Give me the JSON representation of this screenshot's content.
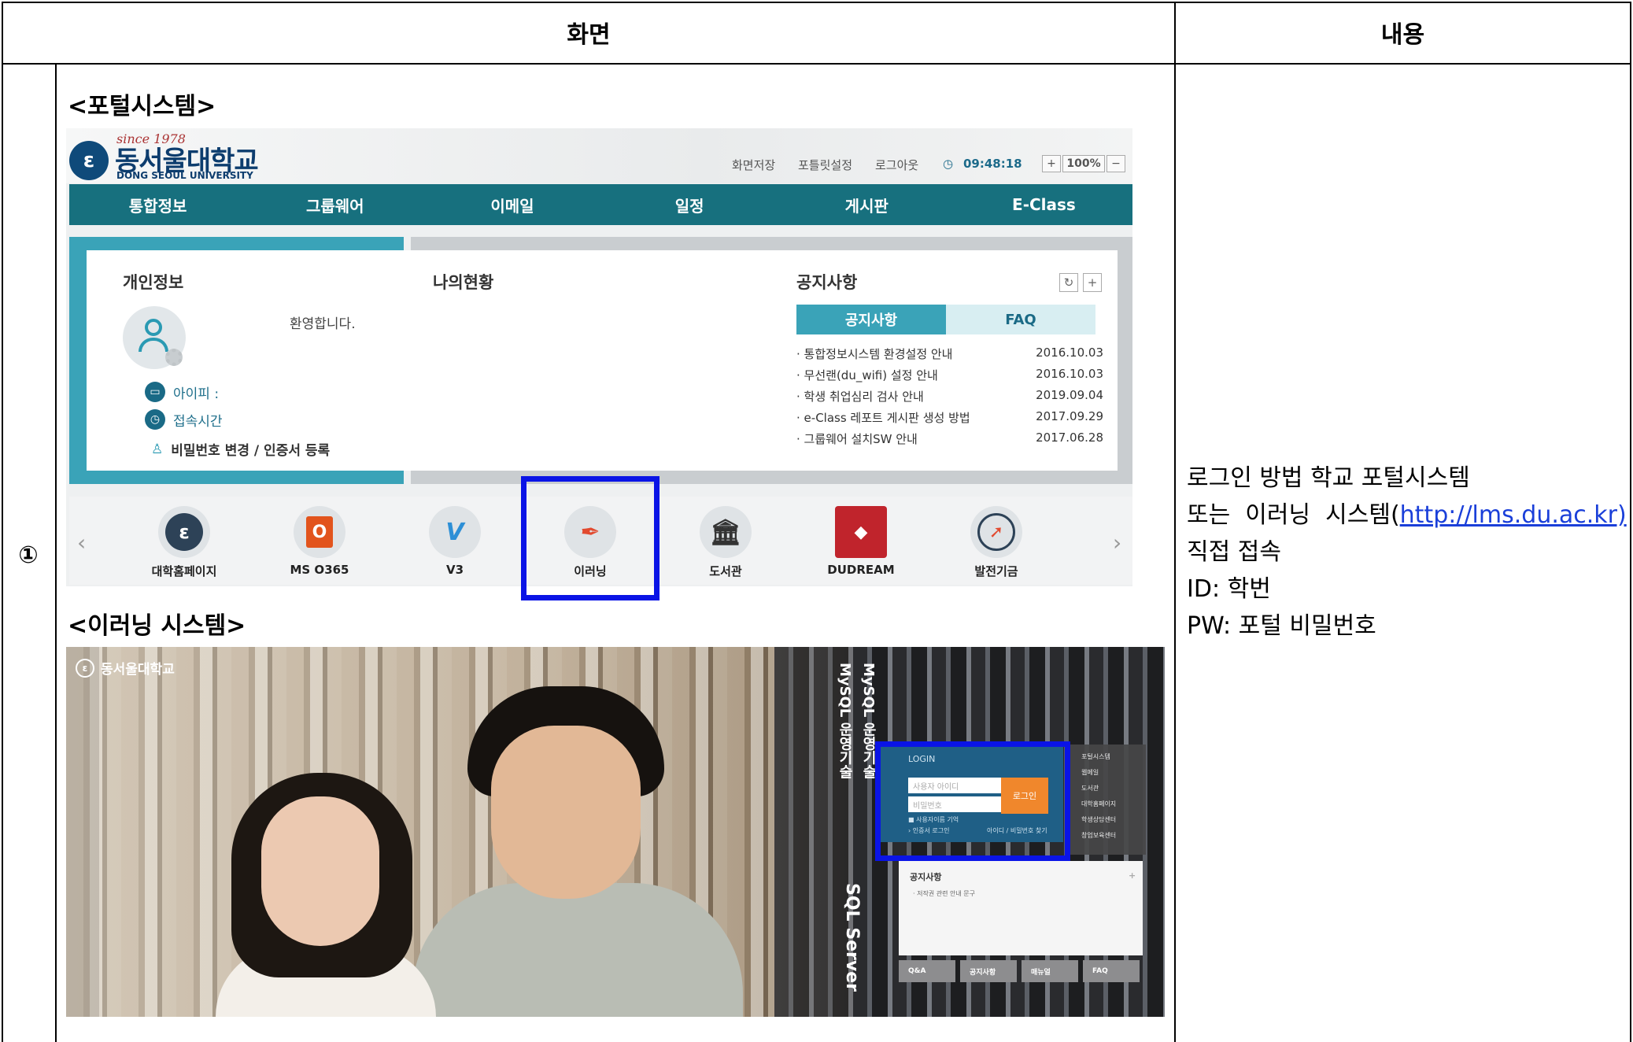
{
  "table": {
    "header_screen": "화면",
    "header_content": "내용",
    "row_number": "①"
  },
  "sections": {
    "portal_title": "<포털시스템>",
    "elearning_title": "<이러닝 시스템>"
  },
  "description": {
    "line1": "로그인 방법 학교 포털시스템",
    "line2_prefix": "또는  이러닝  시스템(",
    "line2_link": "http://lms.du.ac.kr)",
    "line3": "직접 접속",
    "line4": "ID: 학번",
    "line5": "PW: 포털 비밀번호"
  },
  "portal": {
    "logo": {
      "since": "since 1978",
      "name": "동서울대학교",
      "english": "DONG SEOUL UNIVERSITY"
    },
    "utility": {
      "save_screen": "화면저장",
      "portlet_settings": "포틀릿설정",
      "logout": "로그아웃",
      "time": "09:48:18",
      "zoom_in": "+",
      "zoom_level": "100%",
      "zoom_out": "−"
    },
    "nav": [
      "통합정보",
      "그룹웨어",
      "이메일",
      "일정",
      "게시판",
      "E-Class"
    ],
    "personal": {
      "title": "개인정보",
      "welcome": "환영합니다.",
      "ip_label": "아이피 :",
      "access_time": "접속시간",
      "password_change": "비밀번호 변경 / 인증서 등록"
    },
    "status_title": "나의현황",
    "notices": {
      "title": "공지사항",
      "tab_notice": "공지사항",
      "tab_faq": "FAQ",
      "refresh": "↻",
      "more": "+",
      "items": [
        {
          "title": "통합정보시스템 환경설정 안내",
          "date": "2016.10.03"
        },
        {
          "title": "무선랜(du_wifi) 설정 안내",
          "date": "2016.10.03"
        },
        {
          "title": "학생 취업심리 검사 안내",
          "date": "2019.09.04"
        },
        {
          "title": "e-Class 레포트 게시판 생성 방법",
          "date": "2017.09.29"
        },
        {
          "title": "그룹웨어 설치SW 안내",
          "date": "2017.06.28"
        }
      ]
    },
    "quick_links": {
      "prev": "‹",
      "next": "›",
      "items": [
        {
          "label": "대학홈페이지",
          "icon": "university-logo-icon"
        },
        {
          "label": "MS O365",
          "icon": "office-icon"
        },
        {
          "label": "V3",
          "icon": "v3-icon"
        },
        {
          "label": "이러닝",
          "icon": "pen-icon"
        },
        {
          "label": "도서관",
          "icon": "library-icon"
        },
        {
          "label": "DUDREAM",
          "icon": "dudream-icon"
        },
        {
          "label": "발전기금",
          "icon": "compass-icon"
        }
      ]
    }
  },
  "elearning": {
    "logo": "동서울대학교",
    "login": {
      "title": "LOGIN",
      "id_placeholder": "사용자 아이디",
      "pw_placeholder": "비밀번호",
      "button": "로그인",
      "remember": "사용자이름 기억",
      "cert_login": "› 인증서 로그인",
      "find": "아이디 / 비밀번호 찾기"
    },
    "side_menu": [
      "포털시스템",
      "웹메일",
      "도서관",
      "대학홈페이지",
      "학생상담센터",
      "창업보육센터"
    ],
    "notice": {
      "title": "공지사항",
      "more": "+",
      "item": "· 저작권 관련 안내 문구"
    },
    "bottom_tabs": [
      "Q&A",
      "공지사항",
      "매뉴얼",
      "FAQ"
    ]
  },
  "colors": {
    "highlight": "#0a14e6",
    "nav_teal": "#17707e",
    "link": "#1a3fd9"
  }
}
